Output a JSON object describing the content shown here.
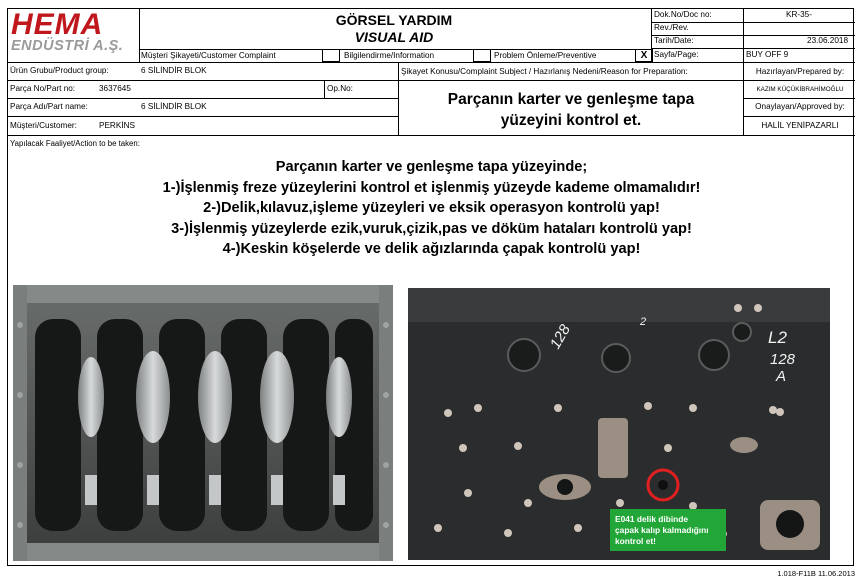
{
  "header": {
    "logo_top": "HEMA",
    "logo_bottom": "ENDÜSTRİ A.Ş.",
    "title": "GÖRSEL YARDIM",
    "subtitle": "VISUAL AID",
    "doc_no_label": "Dok.No/Doc no:",
    "doc_no_value": "KR-35-",
    "rev_label": "Rev./Rev.",
    "rev_value": "",
    "date_label": "Tarih/Date:",
    "date_value": "23.06.2018",
    "page_label": "Sayfa/Page:",
    "page_value": "BUY OFF 9",
    "categories": [
      {
        "label": "Müşteri Şikayeti/Customer Complaint",
        "checked": ""
      },
      {
        "label": "Bilgilendirme/Information",
        "checked": ""
      },
      {
        "label": "Problem Önleme/Preventive",
        "checked": "X"
      }
    ]
  },
  "form": {
    "product_group_label": "Ürün Grubu/Product group:",
    "product_group_value": "6 SİLİNDİR BLOK",
    "part_no_label": "Parça No/Part no:",
    "part_no_value": "3637645",
    "op_no_label": "Op.No:",
    "op_no_value": "",
    "part_name_label": "Parça Adı/Part name:",
    "part_name_value": "6 SİLİNDİR BLOK",
    "customer_label": "Müşteri/Customer:",
    "customer_value": "PERKİNS",
    "subject_label": "Şikayet Konusu/Complaint Subject / Hazırlanış Nedeni/Reason for Preparation:",
    "subject_text_line1": "Parçanın karter ve genleşme tapa",
    "subject_text_line2": "yüzeyini kontrol et.",
    "prepared_by_label": "Hazırlayan/Prepared by:",
    "prepared_by_value": "KAZIM KÜÇÜKİBRAHİMOĞLU",
    "approved_by_label": "Onaylayan/Approved by:",
    "approved_by_value": "HALİL YENİPAZARLI",
    "action_label": "Yapılacak Faaliyet/Action to be taken:"
  },
  "instructions": [
    "Parçanın karter ve genleşme tapa yüzeyinde;",
    "1-)İşlenmiş freze yüzeylerini kontrol et işlenmiş yüzeyde kademe olmamalıdır!",
    "2-)Delik,kılavuz,işleme yüzeyleri ve eksik operasyon kontrolü yap!",
    "3-)İşlenmiş yüzeylerde ezik,vuruk,çizik,pas ve döküm hataları kontrolü yap!",
    "4-)Keskin köşelerde ve delik ağızlarında çapak kontrolü yap!"
  ],
  "photos": {
    "right_marking_1": "L2",
    "right_marking_2": "128",
    "right_marking_3": "A",
    "right_marking_4": "2",
    "callout_line1": "E041 delik dibinde",
    "callout_line2": "çapak kalıp kalmadığını",
    "callout_line3": "kontrol et!",
    "highlight_color": "#e02020",
    "callout_color": "#21a637"
  },
  "footer": {
    "form_code": "1.018-F11B 11.06.2013"
  },
  "colors": {
    "brand_red": "#c0171d",
    "brand_gray": "#9a9a9a"
  }
}
